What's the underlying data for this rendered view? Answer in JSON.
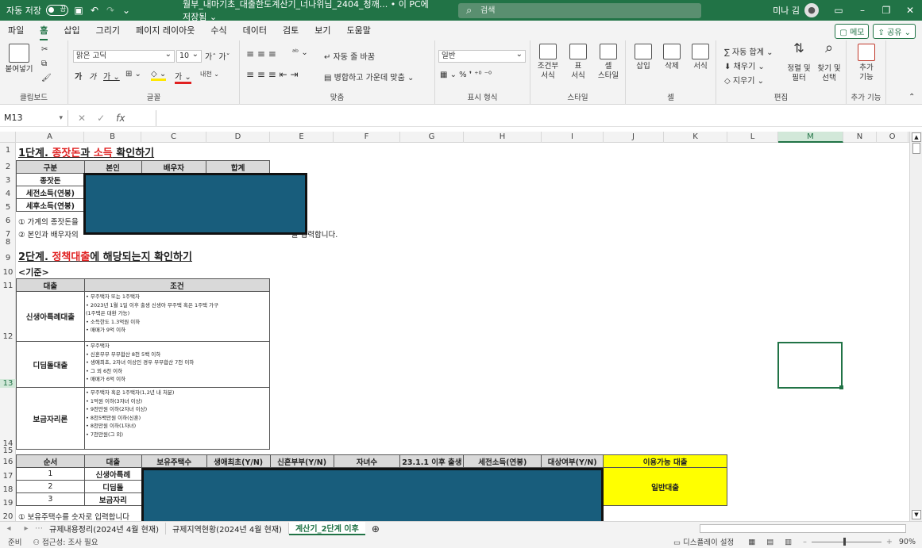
{
  "titlebar": {
    "autosave_label": "자동 저장",
    "autosave_state": "끔",
    "doc_title": "월부_내마기초_대출한도계산기_너나위님_2404_청깨...  • 이 PC에 저장됨 ⌄",
    "search_placeholder": "검색",
    "user_name": "미나 김"
  },
  "menu": {
    "tabs": [
      "파일",
      "홈",
      "삽입",
      "그리기",
      "페이지 레이아웃",
      "수식",
      "데이터",
      "검토",
      "보기",
      "도움말"
    ],
    "memo": "메모",
    "share": "공유"
  },
  "ribbon": {
    "paste": "붙여넣기",
    "clipboard": "클립보드",
    "font_name": "맑은 고딕",
    "font_size": "10",
    "font": "글꼴",
    "wrap_text": "자동 줄 바꿈",
    "merge_center": "병합하고 가운데 맞춤",
    "alignment": "맞춤",
    "number_format": "일반",
    "number": "표시 형식",
    "cond_format": "조건부\n서식",
    "table_format": "표\n서식",
    "cell_style": "셀\n스타일",
    "style": "스타일",
    "insert": "삽입",
    "delete": "삭제",
    "format": "서식",
    "cells": "셀",
    "autosum": "자동 합계",
    "fill": "채우기",
    "clear": "지우기",
    "sort_filter": "정렬 및\n필터",
    "find_select": "찾기 및\n선택",
    "editing": "편집",
    "addins": "추가\n기능",
    "addins_group": "추가 기능"
  },
  "formula_bar": {
    "name_box": "M13",
    "fx": "fx"
  },
  "columns": [
    "A",
    "B",
    "C",
    "D",
    "E",
    "F",
    "G",
    "H",
    "I",
    "J",
    "K",
    "L",
    "M",
    "N",
    "O"
  ],
  "rows": [
    "1",
    "2",
    "3",
    "4",
    "5",
    "6",
    "7",
    "8",
    "9",
    "10",
    "11",
    "12",
    "13",
    "14",
    "15",
    "16",
    "17",
    "18",
    "19",
    "20"
  ],
  "sheet": {
    "step1_prefix": "1단계. ",
    "step1_red1": "종잣돈",
    "step1_mid": "과 ",
    "step1_red2": "소득",
    "step1_suffix": " 확인하기",
    "t1_headers": [
      "구분",
      "본인",
      "배우자",
      "합계"
    ],
    "t1_rows": [
      "종잣돈",
      "세전소득(연봉)",
      "세후소득(연봉)"
    ],
    "note1": "① 가계의 종잣돈을",
    "note2": "② 본인과 배우자의 ",
    "note2_tail": "를 입력합니다.",
    "step2_prefix": "2단계. ",
    "step2_red": "정책대출",
    "step2_suffix": "에 해당되는지 확인하기",
    "criteria": "<기준>",
    "t2_headers": [
      "대출",
      "조건"
    ],
    "loans": [
      {
        "name": "신생아특례대출",
        "conds": [
          "• 무주택자 또는 1주택자",
          "• 2023년 1월 1일 이후 출생 신생아 무주택 혹은 1주택 가구",
          "  (1주택은 대환 가능)",
          "• 소득한도 1.3억원 이하",
          "• 매매가 9억 이하"
        ]
      },
      {
        "name": "디딤돌대출",
        "conds": [
          "• 무주택자",
          "• 신혼부부 부부합산 8천 5백 이하",
          "• 생애최초, 2자녀 이상인 경우 부부합산 7천 이하",
          "• 그 외 6천 이하",
          "• 매매가 6억 이하"
        ]
      },
      {
        "name": "보금자리론",
        "conds": [
          "• 무주택자 혹은 1주택자(1,2년 내 처분)",
          "• 1억원 이하(3자녀 이상)",
          "• 9천만원 이하(2자녀 이상)",
          "• 8천5백만원 이하(신혼)",
          "• 8천만원 이하(1자녀)",
          "• 7천만원(그 외)"
        ]
      }
    ],
    "t3_headers": [
      "순서",
      "대출",
      "보유주택수",
      "생애최초(Y/N)",
      "신혼부부(Y/N)",
      "자녀수",
      "23.1.1 이후 출생",
      "세전소득(연봉)",
      "대상여부(Y/N)",
      "이용가능 대출"
    ],
    "t3_rows": [
      {
        "n": "1",
        "loan": "신생아특례"
      },
      {
        "n": "2",
        "loan": "디딤돌"
      },
      {
        "n": "3",
        "loan": "보금자리"
      }
    ],
    "result": "일반대출",
    "note3": "① 보유주택수를 숫자로 입력합니다"
  },
  "sheet_tabs": [
    "규제내용정리(2024년 4월 현재)",
    "규제지역현황(2024년 4월 현재)",
    "계산기_2단계 이후"
  ],
  "status": {
    "ready": "준비",
    "accessibility": "접근성: 조사 필요",
    "display": "디스플레이 설정",
    "zoom": "90%"
  }
}
